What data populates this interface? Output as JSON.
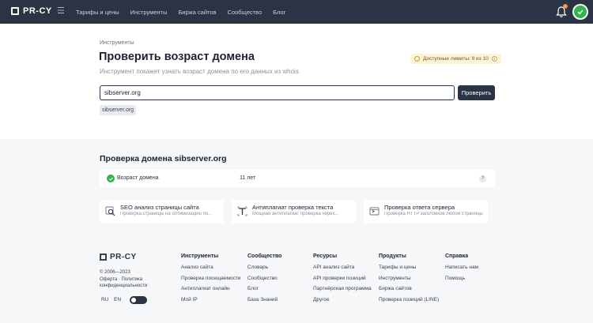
{
  "header": {
    "logo": "PR-CY",
    "nav": [
      "Тарифы и цены",
      "Инструменты",
      "Биржа сайтов",
      "Сообщество",
      "Блог"
    ],
    "notification_count": "1"
  },
  "tool": {
    "breadcrumb": "Инструменты",
    "title": "Проверить возраст домена",
    "subtitle": "Инструмент покажет узнать возраст домена по его данных из whois",
    "limit": "Доступные лимиты: 9 из 10",
    "search_value": "sibserver.org",
    "check_button": "Проверить",
    "history": [
      "sibserver.org"
    ]
  },
  "result": {
    "title": "Проверка домена sibserver.org",
    "row": {
      "label": "Возраст домена",
      "value": "11 лет",
      "help": "?"
    },
    "cards": [
      {
        "title": "SEO анализ страницы сайта",
        "desc": "Проверка страницы на оптимизацию по...",
        "icon": "seo-search-icon"
      },
      {
        "title": "Антиплагиат проверка текста",
        "desc": "Мощная антиплагиат проверка черех...",
        "icon": "text-check-icon"
      },
      {
        "title": "Проверка ответа сервера",
        "desc": "Проверка HTTP заголовков любой страницы",
        "icon": "server-response-icon"
      }
    ]
  },
  "footer": {
    "logo": "PR-CY",
    "copyright": "© 2006—2023",
    "legal": "Оферта · Политика конфиденциальности",
    "lang_ru": "RU",
    "lang_en": "EN",
    "columns": [
      {
        "title": "Инструменты",
        "links": [
          "Анализ сайта",
          "Проверка посещаемости",
          "Антиплагиат онлайн",
          "Мой IP"
        ]
      },
      {
        "title": "Сообщество",
        "links": [
          "Словарь",
          "Сообщество",
          "Блог",
          "База Знаний"
        ]
      },
      {
        "title": "Ресурсы",
        "links": [
          "API анализ сайта",
          "API проверки позиций",
          "Партнёрская программа",
          "Другое"
        ]
      },
      {
        "title": "Продукты",
        "links": [
          "Тарифы и цены",
          "Инструменты",
          "Биржа сайтов",
          "Проверка позиций (LINE)"
        ]
      },
      {
        "title": "Справка",
        "links": [
          "Написать нам",
          "Помощь"
        ]
      }
    ]
  },
  "colors": {
    "header_bg": "#2b3445",
    "accent_green": "#2fb54a",
    "badge_bg": "#fdf3d8",
    "section_bg": "#f6f7f9"
  }
}
